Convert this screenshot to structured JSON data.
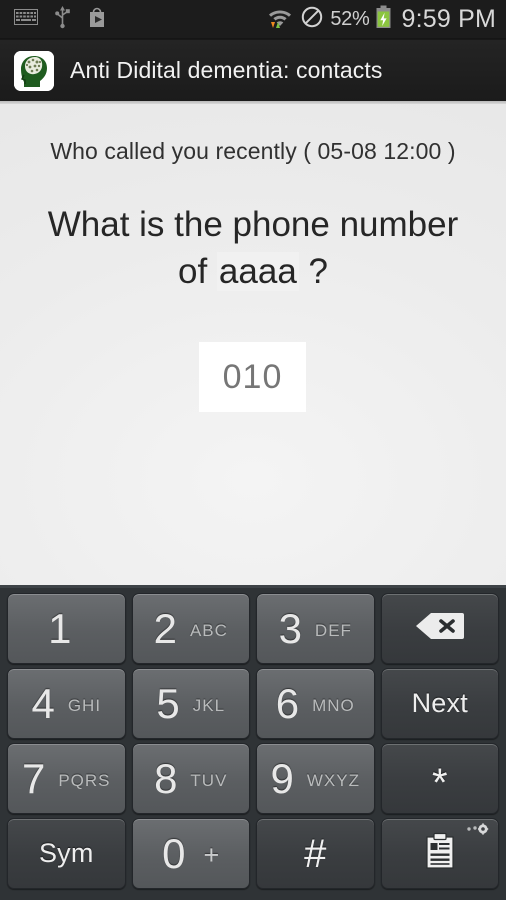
{
  "status_bar": {
    "left_icons": [
      "keyboard-icon",
      "usb-icon",
      "play-store-icon"
    ],
    "wifi_icon": "wifi-data-icon",
    "mute_icon": "do-not-disturb-icon",
    "battery_percent": "52%",
    "battery_icon": "battery-charging-icon",
    "clock": "9:59 PM"
  },
  "action_bar": {
    "app_icon": "brain-head-app-icon",
    "title": "Anti Didital dementia: contacts"
  },
  "content": {
    "prompt": "Who called you recently ( 05-08 12:00 )",
    "question_prefix": "What is the phone number of ",
    "question_line1": "What is the phone number",
    "question_line2_prefix": "of ",
    "question_name": "aaaa",
    "question_suffix": " ?",
    "answer_value": "010"
  },
  "keyboard": {
    "rows": [
      [
        {
          "name": "key-1",
          "type": "num",
          "digit": "1",
          "letters": ""
        },
        {
          "name": "key-2",
          "type": "num",
          "digit": "2",
          "letters": "ABC"
        },
        {
          "name": "key-3",
          "type": "num",
          "digit": "3",
          "letters": "DEF"
        },
        {
          "name": "key-backspace",
          "type": "fn",
          "icon": "backspace-icon",
          "label": ""
        }
      ],
      [
        {
          "name": "key-4",
          "type": "num",
          "digit": "4",
          "letters": "GHI"
        },
        {
          "name": "key-5",
          "type": "num",
          "digit": "5",
          "letters": "JKL"
        },
        {
          "name": "key-6",
          "type": "num",
          "digit": "6",
          "letters": "MNO"
        },
        {
          "name": "key-next",
          "type": "fn",
          "icon": "",
          "label": "Next"
        }
      ],
      [
        {
          "name": "key-7",
          "type": "num",
          "digit": "7",
          "letters": "PQRS"
        },
        {
          "name": "key-8",
          "type": "num",
          "digit": "8",
          "letters": "TUV"
        },
        {
          "name": "key-9",
          "type": "num",
          "digit": "9",
          "letters": "WXYZ"
        },
        {
          "name": "key-asterisk",
          "type": "fn",
          "icon": "",
          "label": "*"
        }
      ],
      [
        {
          "name": "key-sym",
          "type": "fn",
          "icon": "",
          "label": "Sym"
        },
        {
          "name": "key-0",
          "type": "num",
          "digit": "0",
          "letters": "+"
        },
        {
          "name": "key-hash",
          "type": "fn",
          "icon": "",
          "label": "#"
        },
        {
          "name": "key-clipboard",
          "type": "fn",
          "icon": "clipboard-icon",
          "label": ""
        }
      ]
    ],
    "labels": {
      "k1_digit": "1",
      "k1_letters": "",
      "k2_digit": "2",
      "k2_letters": "ABC",
      "k3_digit": "3",
      "k3_letters": "DEF",
      "k4_digit": "4",
      "k4_letters": "GHI",
      "k5_digit": "5",
      "k5_letters": "JKL",
      "k6_digit": "6",
      "k6_letters": "MNO",
      "k7_digit": "7",
      "k7_letters": "PQRS",
      "k8_digit": "8",
      "k8_letters": "TUV",
      "k9_digit": "9",
      "k9_letters": "WXYZ",
      "k0_digit": "0",
      "k0_plus": "+",
      "next": "Next",
      "sym": "Sym",
      "asterisk": "*",
      "hash": "#"
    }
  },
  "colors": {
    "status_bar_bg": "#1c1c1c",
    "action_bar_bg": "#1f1f1f",
    "content_bg": "#ebebeb",
    "keyboard_bg": "#2f3336",
    "key_num": "#5e6164",
    "key_fn": "#3c3f42",
    "battery_green": "#8bc53f",
    "data_arrow_orange": "#ef8b20"
  }
}
